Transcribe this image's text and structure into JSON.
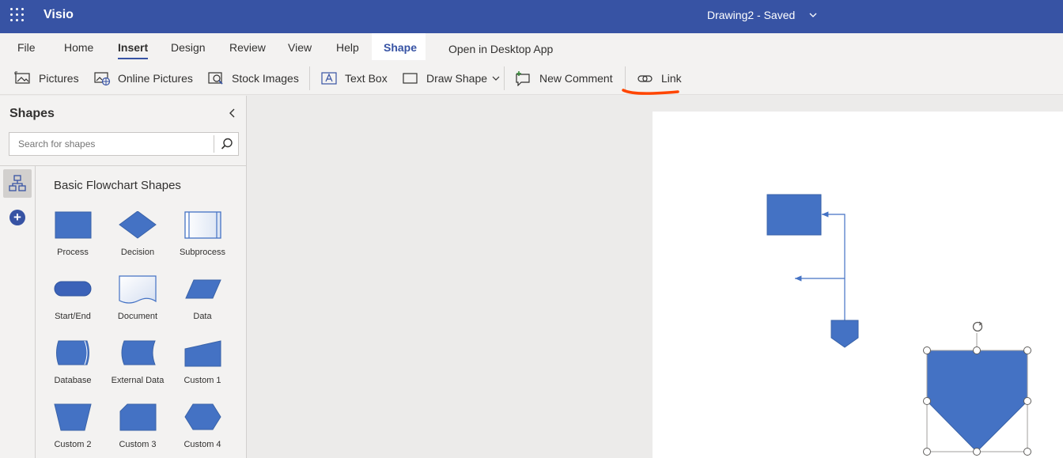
{
  "app": {
    "name": "Visio",
    "document": "Drawing2 - Saved"
  },
  "tabs": [
    "File",
    "Home",
    "Insert",
    "Design",
    "Review",
    "View",
    "Help",
    "Shape",
    "Open in Desktop App"
  ],
  "active_tab": "Insert",
  "commands": {
    "pictures": "Pictures",
    "online_pictures": "Online Pictures",
    "stock_images": "Stock Images",
    "text_box": "Text Box",
    "draw_shape": "Draw Shape",
    "new_comment": "New Comment",
    "link": "Link"
  },
  "shapes_panel": {
    "title": "Shapes",
    "search_placeholder": "Search for shapes",
    "stencil": "Basic Flowchart Shapes",
    "items": [
      "Process",
      "Decision",
      "Subprocess",
      "Start/End",
      "Document",
      "Data",
      "Database",
      "External Data",
      "Custom 1",
      "Custom 2",
      "Custom 3",
      "Custom 4"
    ]
  },
  "colors": {
    "brand": "#3753a4",
    "shape_fill": "#4472c4",
    "annotation": "#ff4500"
  }
}
